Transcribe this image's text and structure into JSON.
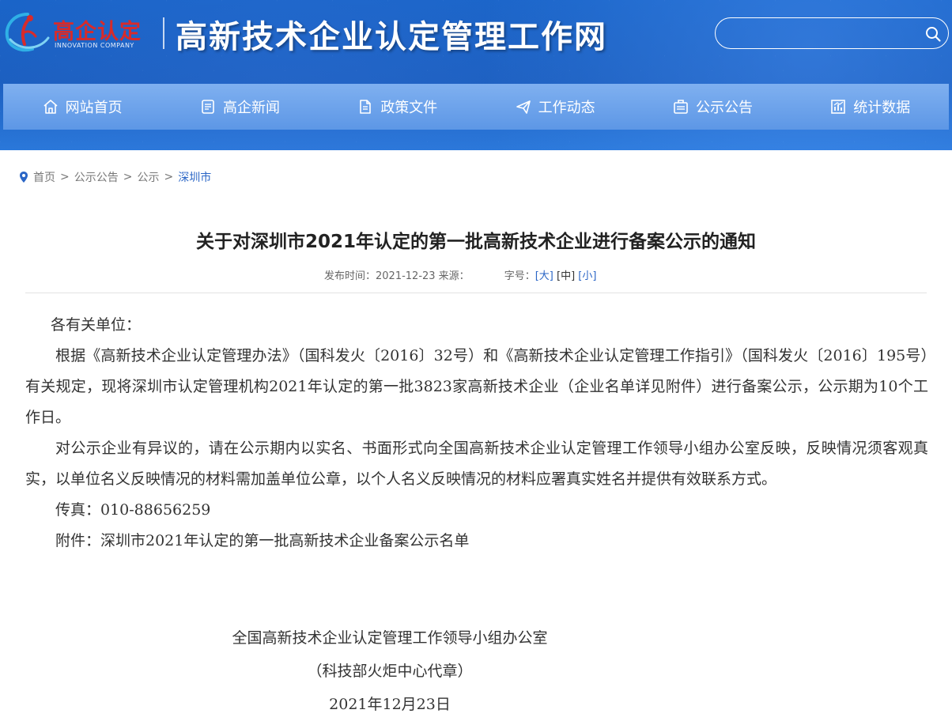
{
  "header": {
    "logo_cn": "高企认定",
    "logo_en": "INNOVATION COMPANY",
    "site_title": "高新技术企业认定管理工作网",
    "search_placeholder": ""
  },
  "nav": {
    "items": [
      {
        "label": "网站首页",
        "icon": "home-icon"
      },
      {
        "label": "高企新闻",
        "icon": "news-icon"
      },
      {
        "label": "政策文件",
        "icon": "document-icon"
      },
      {
        "label": "工作动态",
        "icon": "paper-plane-icon"
      },
      {
        "label": "公示公告",
        "icon": "notice-icon"
      },
      {
        "label": "统计数据",
        "icon": "chart-icon"
      }
    ]
  },
  "breadcrumb": {
    "items": [
      "首页",
      "公示公告",
      "公示",
      "深圳市"
    ],
    "separator": ">"
  },
  "article": {
    "title": "关于对深圳市2021年认定的第一批高新技术企业进行备案公示的通知",
    "meta_published": "发布时间：2021-12-23 来源：",
    "meta_font_label": "字号：",
    "font_large": "[大]",
    "font_medium": "[中]",
    "font_small": "[小]",
    "salutation": "各有关单位：",
    "para1": "根据《高新技术企业认定管理办法》（国科发火〔2016〕32号）和《高新技术企业认定管理工作指引》（国科发火〔2016〕195号）有关规定，现将深圳市认定管理机构2021年认定的第一批3823家高新技术企业（企业名单详见附件）进行备案公示，公示期为10个工作日。",
    "para2": "对公示企业有异议的，请在公示期内以实名、书面形式向全国高新技术企业认定管理工作领导小组办公室反映，反映情况须客观真实，以单位名义反映情况的材料需加盖单位公章，以个人名义反映情况的材料应署真实姓名并提供有效联系方式。",
    "fax": "传真：010-88656259",
    "attachment": "附件：深圳市2021年认定的第一批高新技术企业备案公示名单",
    "sign_org": "全国高新技术企业认定管理工作领导小组办公室",
    "sign_agent": "（科技部火炬中心代章）",
    "sign_date": "2021年12月23日"
  },
  "colors": {
    "header_blue": "#1c5fc0",
    "nav_blue": "#6aa1ea",
    "logo_red": "#d72b2b",
    "link_blue": "#2b66c6"
  }
}
